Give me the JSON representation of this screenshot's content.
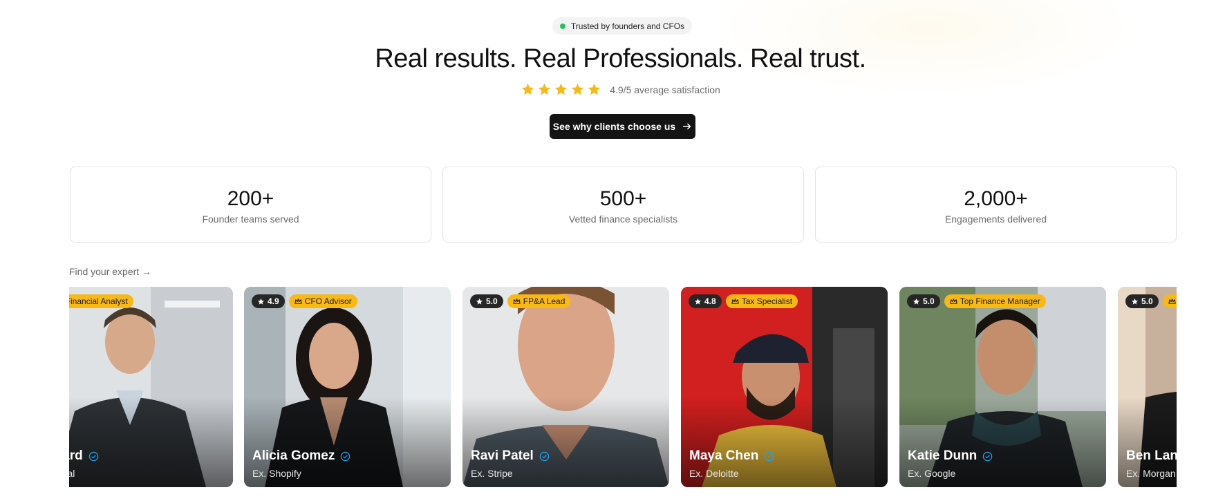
{
  "badge": {
    "text": "Trusted by founders and CFOs"
  },
  "headline": "Real results. Real Professionals. Real trust.",
  "rating": {
    "stars": 5,
    "text": "4.9/5 average satisfaction",
    "star_color": "#f8b915"
  },
  "cta": {
    "label": "See why clients choose us",
    "icon": "arrow-right-icon"
  },
  "stats": [
    {
      "value": "200+",
      "label": "Founder teams served"
    },
    {
      "value": "500+",
      "label": "Vetted finance specialists"
    },
    {
      "value": "2,000+",
      "label": "Engagements delivered"
    }
  ],
  "experts_link": "Find your expert →",
  "experts": [
    {
      "name": "Gerrard",
      "prev": "ia Capital",
      "rating": "",
      "role": "Top Financial Analyst"
    },
    {
      "name": "Alicia Gomez",
      "prev": "Ex. Shopify",
      "rating": "4.9",
      "role": "CFO Advisor"
    },
    {
      "name": "Ravi Patel",
      "prev": "Ex. Stripe",
      "rating": "5.0",
      "role": "FP&A Lead"
    },
    {
      "name": "Maya Chen",
      "prev": "Ex. Deloitte",
      "rating": "4.8",
      "role": "Tax Specialist"
    },
    {
      "name": "Katie Dunn",
      "prev": "Ex. Google",
      "rating": "5.0",
      "role": "Top Finance Manager"
    },
    {
      "name": "Ben Lang",
      "prev": "Ex. Morgan",
      "rating": "5.0",
      "role": ""
    }
  ],
  "colors": {
    "accent_yellow": "#f8b915",
    "status_green": "#22c55e",
    "verified_blue": "#1da1f2",
    "cta_bg": "#141414"
  }
}
